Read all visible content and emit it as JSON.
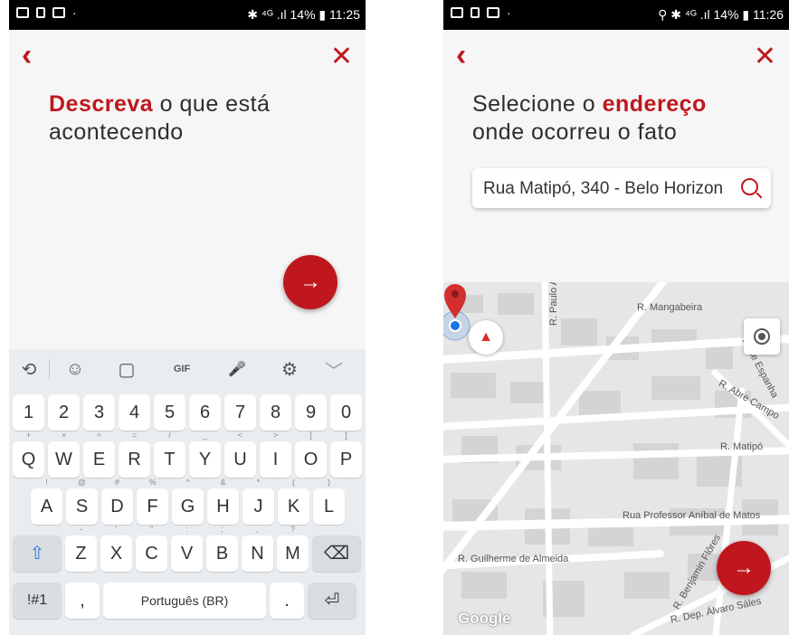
{
  "left_screen": {
    "status": {
      "right": "✱ ⁴ᴳ .ıl 14% ▮ 11:25",
      "dot": "·"
    },
    "title_highlight": "Descreva",
    "title_rest": " o que está acontecendo",
    "back_label": "‹",
    "close_label": "✕",
    "next_label": "→",
    "keyboard": {
      "toolbar": [
        "⟲",
        "☺",
        "▢",
        "GIF",
        "🎤",
        "⚙",
        "﹀"
      ],
      "row1": [
        "1",
        "2",
        "3",
        "4",
        "5",
        "6",
        "7",
        "8",
        "9",
        "0"
      ],
      "row2": [
        "Q",
        "W",
        "E",
        "R",
        "T",
        "Y",
        "U",
        "I",
        "O",
        "P"
      ],
      "row2_sup": [
        "+",
        "×",
        "÷",
        "=",
        "/",
        "_",
        "<",
        ">",
        "[",
        "]"
      ],
      "row3": [
        "A",
        "S",
        "D",
        "F",
        "G",
        "H",
        "J",
        "K",
        "L"
      ],
      "row3_sup": [
        "!",
        "@",
        "#",
        "%",
        "^",
        "&",
        "*",
        "(",
        ")"
      ],
      "row4": [
        "Z",
        "X",
        "C",
        "V",
        "B",
        "N",
        "M"
      ],
      "row4_sup": [
        "-",
        "'",
        "\"",
        ":",
        ";",
        ",",
        "?"
      ],
      "shift": "⇧",
      "backspace": "⌫",
      "symbols": "!#1",
      "comma": ",",
      "space": "Português (BR)",
      "period": ".",
      "enter": "⏎"
    }
  },
  "right_screen": {
    "status": {
      "right": "⚲ ✱ ⁴ᴳ .ıl 14% ▮ 11:26",
      "dot": "·"
    },
    "title_pre": "Selecione o ",
    "title_highlight": "endereço",
    "title_post": " onde ocorreu o fato",
    "back_label": "‹",
    "close_label": "✕",
    "next_label": "→",
    "address_value": "Rua Matipó, 340 - Belo Horizon",
    "map_labels": {
      "paulo": "R. Paulo Af",
      "mangabeira": "R. Mangabeira",
      "espanha": "R. de Espanha",
      "abre_campo": "R. Abre Campo",
      "matipo": "R. Matipó",
      "anibal": "Rua Professor Aníbal de Matos",
      "guilherme": "R. Guilherme de Almeida",
      "benjamin": "R. Benjamin Flôres",
      "alvaro": "R. Dep. Álvaro Sáles"
    },
    "google": "Google"
  },
  "colors": {
    "accent": "#c0171e",
    "pin": "#d32f2f",
    "location": "#1a73e8"
  }
}
